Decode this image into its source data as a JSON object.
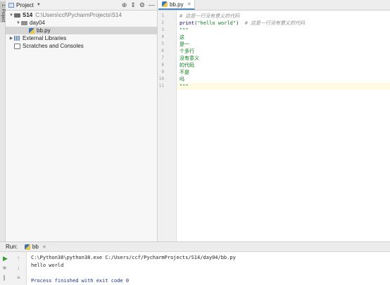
{
  "side_stripe": {
    "project_tab_label": "1: Project"
  },
  "project_panel": {
    "title": "Project",
    "tree": [
      {
        "label": "S14",
        "path": "C:\\Users\\ccf\\PycharmProjects\\S14"
      },
      {
        "label": "day04"
      },
      {
        "label": "bb.py"
      },
      {
        "label": "External Libraries"
      },
      {
        "label": "Scratches and Consoles"
      }
    ]
  },
  "editor": {
    "tab_label": "bb.py",
    "line_numbers": [
      "1",
      "2",
      "3",
      "4",
      "5",
      "6",
      "7",
      "8",
      "9",
      "10",
      "11"
    ],
    "lines": [
      {
        "parts": [
          {
            "cls": "comment",
            "text": "# 这是一行没有意义的代码"
          }
        ]
      },
      {
        "parts": [
          {
            "cls": "fn",
            "text": "print"
          },
          {
            "cls": "",
            "text": "("
          },
          {
            "cls": "str",
            "text": "\"hello world\""
          },
          {
            "cls": "",
            "text": ")  "
          },
          {
            "cls": "comment",
            "text": "# 这是一行没有意义的代码"
          }
        ]
      },
      {
        "parts": [
          {
            "cls": "docs",
            "text": "\"\"\""
          }
        ]
      },
      {
        "parts": [
          {
            "cls": "docs",
            "text": "这"
          }
        ]
      },
      {
        "parts": [
          {
            "cls": "docs",
            "text": "是一"
          }
        ]
      },
      {
        "parts": [
          {
            "cls": "docs",
            "text": "个多行"
          }
        ]
      },
      {
        "parts": [
          {
            "cls": "docs",
            "text": "没有意义"
          }
        ]
      },
      {
        "parts": [
          {
            "cls": "docs",
            "text": "的代码"
          }
        ]
      },
      {
        "parts": [
          {
            "cls": "docs",
            "text": "不是"
          }
        ]
      },
      {
        "parts": [
          {
            "cls": "docs",
            "text": "吗"
          }
        ]
      },
      {
        "parts": [
          {
            "cls": "docs",
            "text": "\"\"\""
          }
        ]
      }
    ]
  },
  "run_panel": {
    "label": "Run:",
    "tab_label": "bb",
    "console_lines": [
      "C:\\Python38\\python38.exe C:/Users/ccf/PycharmProjects/S14/day04/bb.py",
      "hello world",
      "",
      "Process finished with exit code 0"
    ]
  },
  "colors": {
    "comment": "#8c8c8c",
    "string": "#067d17",
    "current_line": "#fffae3",
    "selection": "#d5d5d5"
  }
}
